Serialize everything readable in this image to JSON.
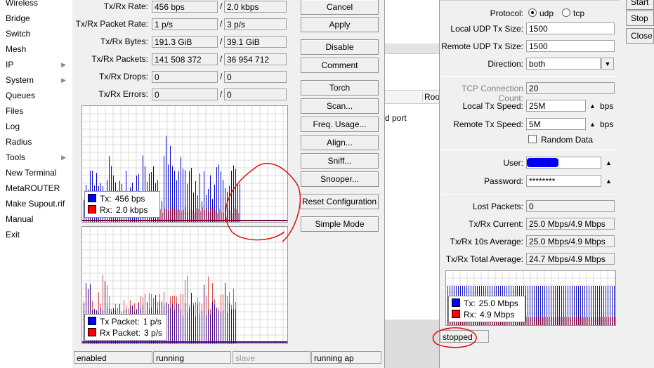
{
  "menu": {
    "items": [
      {
        "label": "Wireless",
        "arrow": false
      },
      {
        "label": "Bridge",
        "arrow": false
      },
      {
        "label": "Switch",
        "arrow": false
      },
      {
        "label": "Mesh",
        "arrow": false
      },
      {
        "label": "IP",
        "arrow": true
      },
      {
        "label": "System",
        "arrow": true
      },
      {
        "label": "Queues",
        "arrow": false
      },
      {
        "label": "Files",
        "arrow": false
      },
      {
        "label": "Log",
        "arrow": false
      },
      {
        "label": "Radius",
        "arrow": false
      },
      {
        "label": "Tools",
        "arrow": true
      },
      {
        "label": "New Terminal",
        "arrow": false
      },
      {
        "label": "MetaROUTER",
        "arrow": false
      },
      {
        "label": "Make Supout.rif",
        "arrow": false
      },
      {
        "label": "Manual",
        "arrow": false
      },
      {
        "label": "Exit",
        "arrow": false
      }
    ]
  },
  "interface": {
    "stats": [
      {
        "label": "Tx/Rx Rate:",
        "tx": "456 bps",
        "rx": "2.0 kbps"
      },
      {
        "label": "Tx/Rx Packet Rate:",
        "tx": "1 p/s",
        "rx": "3 p/s"
      },
      {
        "label": "Tx/Rx Bytes:",
        "tx": "191.3 GiB",
        "rx": "39.1 GiB"
      },
      {
        "label": "Tx/Rx Packets:",
        "tx": "141 508 372",
        "rx": "36 954 712"
      },
      {
        "label": "Tx/Rx Drops:",
        "tx": "0",
        "rx": "0"
      },
      {
        "label": "Tx/Rx Errors:",
        "tx": "0",
        "rx": "0"
      }
    ],
    "separator": "/",
    "buttons": {
      "cancel": "Cancel",
      "apply": "Apply",
      "disable": "Disable",
      "comment": "Comment",
      "torch": "Torch",
      "scan": "Scan...",
      "freq_usage": "Freq. Usage...",
      "align": "Align...",
      "sniff": "Sniff...",
      "snooper": "Snooper...",
      "reset_config": "Reset Configuration",
      "simple_mode": "Simple Mode"
    },
    "traffic_legend": {
      "tx": "Tx:",
      "tx_val": "456 bps",
      "rx": "Rx:",
      "rx_val": "2.0 kbps"
    },
    "packet_legend": {
      "tx": "Tx Packet:",
      "tx_val": "1 p/s",
      "rx": "Rx Packet:",
      "rx_val": "3 p/s"
    },
    "status": [
      "enabled",
      "running",
      "slave",
      "running ap"
    ]
  },
  "middle": {
    "column_header": "Root",
    "row_text": "d port"
  },
  "btest": {
    "protocol_label": "Protocol:",
    "protocol_udp": "udp",
    "protocol_tcp": "tcp",
    "local_udp_label": "Local UDP Tx Size:",
    "local_udp": "1500",
    "remote_udp_label": "Remote UDP Tx Size:",
    "remote_udp": "1500",
    "direction_label": "Direction:",
    "direction": "both",
    "tcp_count_label": "TCP Connection Count:",
    "tcp_count": "20",
    "local_speed_label": "Local Tx Speed:",
    "local_speed": "25M",
    "remote_speed_label": "Remote Tx Speed:",
    "remote_speed": "5M",
    "unit": "bps",
    "random_data": "Random Data",
    "user_label": "User:",
    "password_label": "Password:",
    "password": "********",
    "lost_label": "Lost Packets:",
    "lost": "0",
    "current_label": "Tx/Rx Current:",
    "current": "25.0 Mbps/4.9 Mbps",
    "avg10_label": "Tx/Rx 10s Average:",
    "avg10": "25.0 Mbps/4.9 Mbps",
    "total_label": "Tx/Rx Total Average:",
    "total": "24.7 Mbps/4.9 Mbps",
    "legend": {
      "tx": "Tx:",
      "tx_val": "25.0 Mbps",
      "rx": "Rx:",
      "rx_val": "4.9 Mbps"
    },
    "status": "stopped",
    "buttons": {
      "start": "Start",
      "stop": "Stop",
      "close": "Close"
    }
  },
  "colors": {
    "tx": "#0000ff",
    "rx": "#ff0000",
    "annotation": "#e01010",
    "redact": "#0000ee"
  }
}
